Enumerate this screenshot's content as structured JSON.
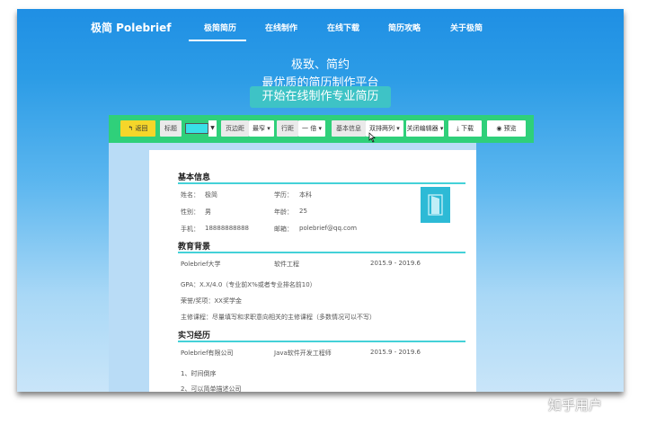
{
  "nav": {
    "brand": "极简 Polebrief",
    "items": [
      "极简简历",
      "在线制作",
      "在线下载",
      "简历攻略",
      "关于极简"
    ]
  },
  "hero": {
    "line1": "极致、简约",
    "line2": "最优质的简历制作平台",
    "button": "开始在线制作专业简历"
  },
  "toolbar": {
    "back": "返回",
    "label_title": "标题",
    "label_margin": "页边距",
    "margin_value": "最窄",
    "label_linespacing": "行距",
    "linespacing_value": "一 倍",
    "label_basicinfo": "基本信息",
    "basicinfo_value": "双排两列",
    "close_editor": "关闭编辑器",
    "download": "下载",
    "preview": "预览",
    "title_color": "#39e0e8"
  },
  "resume": {
    "basic": {
      "title": "基本信息",
      "name_label": "姓名：",
      "name": "极简",
      "edu_label": "学历：",
      "edu": "本科",
      "gender_label": "性别：",
      "gender": "男",
      "age_label": "年龄：",
      "age": "25",
      "phone_label": "手机：",
      "phone": "18888888888",
      "email_label": "邮箱：",
      "email": "polebrief@qq.com"
    },
    "education": {
      "title": "教育背景",
      "school": "Polebrief大学",
      "major": "软件工程",
      "period": "2015.9 - 2019.6",
      "gpa": "GPA：X.X/4.0（专业前X%或者专业排名前10）",
      "honors": "荣誉/奖项：XX奖学金",
      "courses": "主修课程：尽量填写和求职意向相关的主修课程（多数情况可以不写）"
    },
    "internship": {
      "title": "实习经历",
      "company": "Polebrief有限公司",
      "position": "Java软件开发工程师",
      "period": "2015.9 - 2019.6",
      "item1": "1、时间倒序",
      "item2": "2、可以简单描述公司"
    }
  },
  "watermark": "知乎用户"
}
